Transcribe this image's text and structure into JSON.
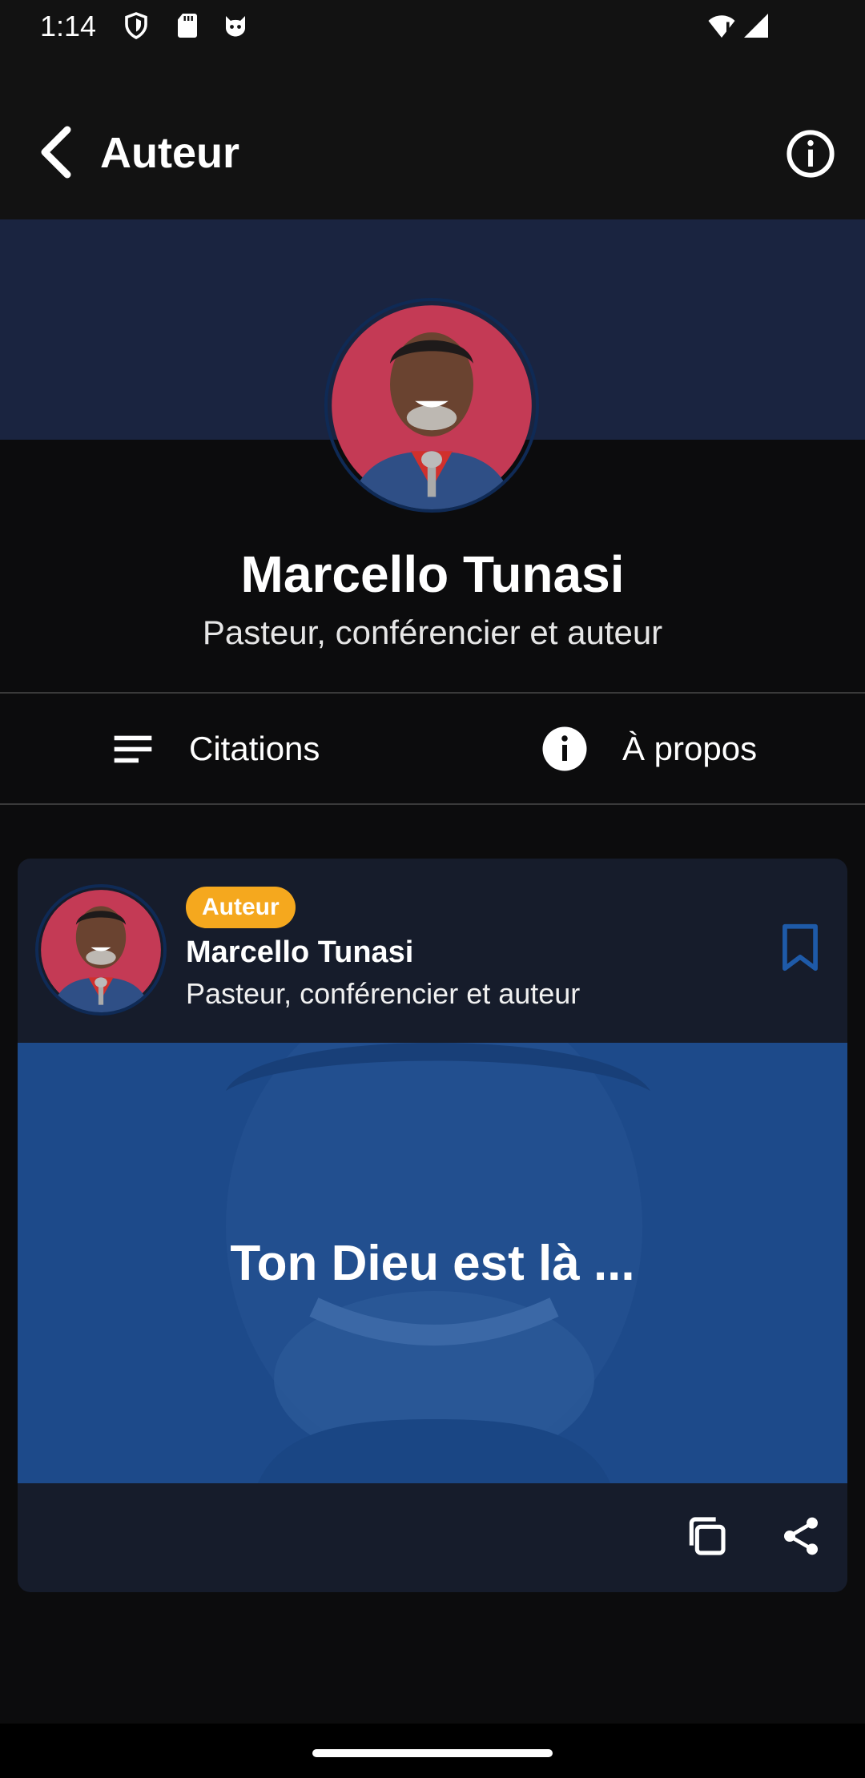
{
  "status_bar": {
    "time": "1:14",
    "left_icons": [
      "shield-icon",
      "sd-card-icon",
      "cat-face-icon"
    ],
    "right_icons": [
      "wifi-alert-icon",
      "signal-icon"
    ]
  },
  "app_bar": {
    "title": "Auteur",
    "back_icon": "chevron-left-icon",
    "info_icon": "info-icon"
  },
  "profile": {
    "name": "Marcello Tunasi",
    "role": "Pasteur, conférencier et auteur"
  },
  "tabs": [
    {
      "label": "Citations",
      "icon": "list-lines-icon"
    },
    {
      "label": "À propos",
      "icon": "info-filled-icon"
    }
  ],
  "card": {
    "badge": "Auteur",
    "name": "Marcello Tunasi",
    "role": "Pasteur, conférencier et auteur",
    "quote": "Ton Dieu est là ...",
    "actions": [
      "copy-icon",
      "share-icon"
    ],
    "bookmark_icon": "bookmark-outline-icon"
  },
  "colors": {
    "background": "#0c0c0d",
    "hero_band": "#1a2440",
    "card_bg": "#161c2b",
    "badge": "#f5a81e",
    "accent_blue": "#1e5aa8",
    "quote_overlay": "#1d4a8a"
  }
}
